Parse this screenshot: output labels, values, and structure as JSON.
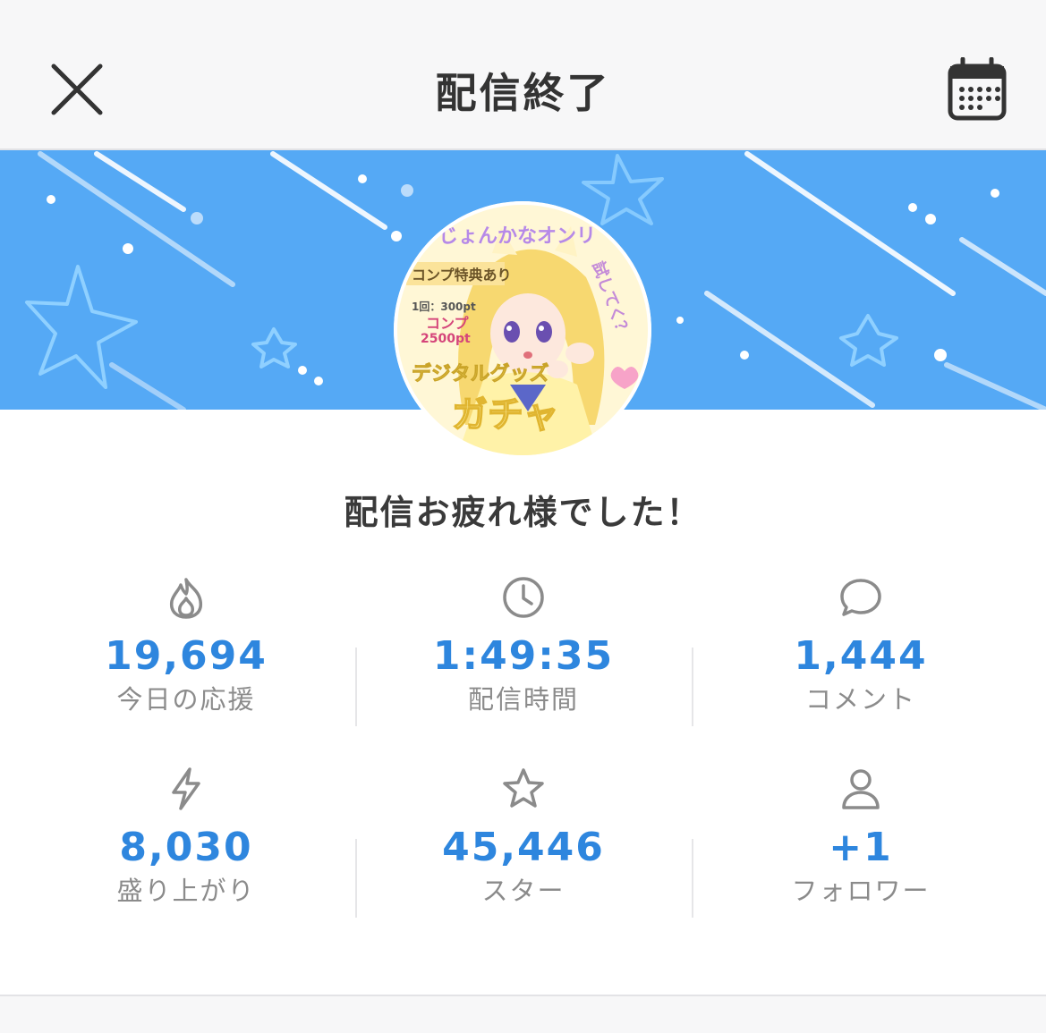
{
  "header": {
    "title": "配信終了",
    "close_icon": "close-icon",
    "calendar_icon": "calendar-icon"
  },
  "avatar": {
    "caption_top": "じょんかなオンリ",
    "caption_badge": "コンプ特典あり",
    "caption_price": "1回：300pt",
    "caption_comp": "コンプ",
    "caption_comp_pt": "2500pt",
    "caption_side": "試してく？",
    "caption_digital": "デジタルグッズ",
    "caption_gacha": "ガチャ"
  },
  "thanks_message": "配信お疲れ様でした！",
  "stats": [
    {
      "icon": "flame-icon",
      "value": "19,694",
      "label": "今日の応援"
    },
    {
      "icon": "clock-icon",
      "value": "1:49:35",
      "label": "配信時間"
    },
    {
      "icon": "comment-icon",
      "value": "1,444",
      "label": "コメント"
    },
    {
      "icon": "lightning-icon",
      "value": "8,030",
      "label": "盛り上がり"
    },
    {
      "icon": "star-icon",
      "value": "45,446",
      "label": "スター"
    },
    {
      "icon": "person-icon",
      "value": "+1",
      "label": "フォロワー"
    }
  ],
  "colors": {
    "accent": "#2e86de",
    "banner": "#55a9f5",
    "label": "#8b8b8b"
  }
}
